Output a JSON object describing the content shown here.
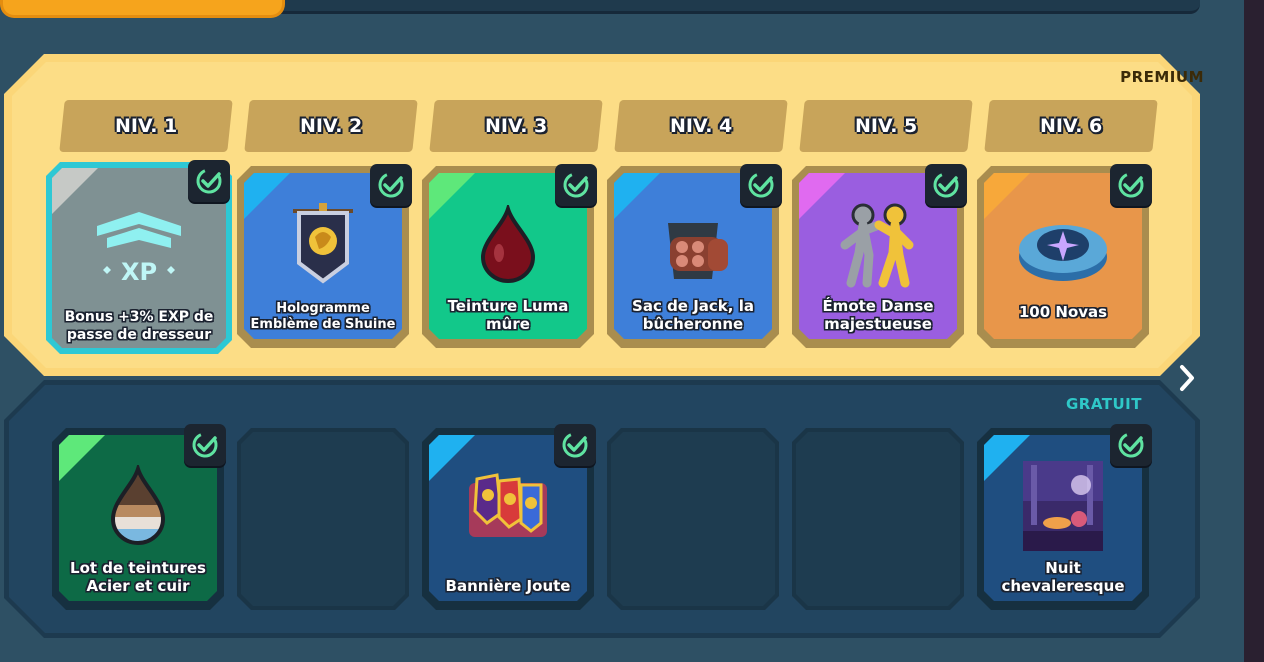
{
  "premium": {
    "label": "PREMIUM",
    "levels": [
      "NIV. 1",
      "NIV. 2",
      "NIV. 3",
      "NIV. 4",
      "NIV. 5",
      "NIV. 6"
    ],
    "rewards": [
      {
        "name": "Bonus +3% EXP de passe de dresseur",
        "icon": "xp-boost-icon",
        "claimed": true
      },
      {
        "name": "Hologramme Emblème de Shuine",
        "icon": "banner-emblem-icon",
        "claimed": true
      },
      {
        "name": "Teinture Luma mûre",
        "icon": "dye-drop-icon",
        "claimed": true
      },
      {
        "name": "Sac de Jack, la bûcheronne",
        "icon": "log-bag-icon",
        "claimed": true
      },
      {
        "name": "Émote Danse majestueuse",
        "icon": "dance-emote-icon",
        "claimed": true
      },
      {
        "name": "100 Novas",
        "icon": "nova-currency-icon",
        "claimed": true
      }
    ]
  },
  "free": {
    "label": "GRATUIT",
    "rewards": [
      {
        "name": "Lot de teintures Acier et cuir",
        "icon": "dye-bundle-icon",
        "claimed": true
      },
      {
        "name": "",
        "icon": "",
        "claimed": false
      },
      {
        "name": "Bannière Joute",
        "icon": "joust-banner-icon",
        "claimed": true
      },
      {
        "name": "",
        "icon": "",
        "claimed": false
      },
      {
        "name": "",
        "icon": "",
        "claimed": false
      },
      {
        "name": "Nuit chevaleresque",
        "icon": "knight-night-image",
        "claimed": true
      }
    ]
  },
  "xp_badge_text": "XP",
  "colors": {
    "premium_bg": "#fcdd86",
    "free_bg": "#224560",
    "free_label": "#2fc8c8",
    "check": "#5fe3a1"
  }
}
